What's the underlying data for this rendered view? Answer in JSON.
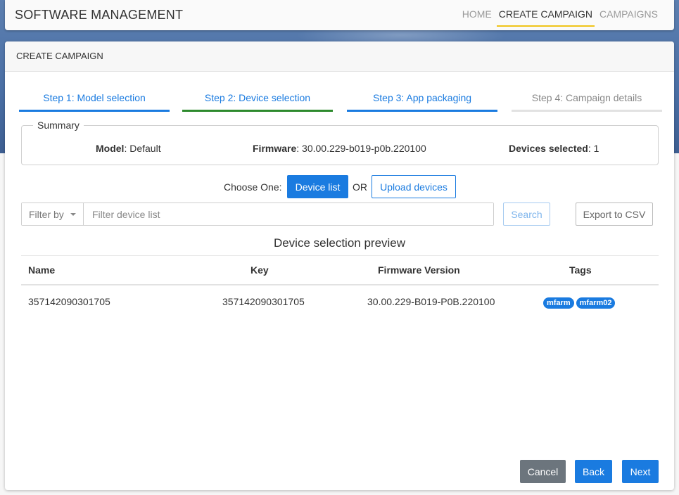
{
  "app": {
    "title": "SOFTWARE MANAGEMENT"
  },
  "nav": {
    "items": [
      {
        "label": "HOME",
        "active": false
      },
      {
        "label": "CREATE CAMPAIGN",
        "active": true
      },
      {
        "label": "CAMPAIGNS",
        "active": false
      }
    ]
  },
  "card": {
    "title": "CREATE CAMPAIGN"
  },
  "steps": [
    {
      "label": "Step 1: Model selection",
      "state": "complete"
    },
    {
      "label": "Step 2: Device selection",
      "state": "current"
    },
    {
      "label": "Step 3: App packaging",
      "state": "complete"
    },
    {
      "label": "Step 4: Campaign details",
      "state": "pending"
    }
  ],
  "summary": {
    "legend": "Summary",
    "model_key": "Model",
    "model_value": ": Default",
    "firmware_key": "Firmware",
    "firmware_value": ": 30.00.229-b019-p0b.220100",
    "devices_key": "Devices selected",
    "devices_value": ": 1"
  },
  "choose": {
    "label": "Choose One:",
    "device_list": "Device list",
    "or": "OR",
    "upload": "Upload devices"
  },
  "filter": {
    "filter_by": "Filter by",
    "placeholder": "Filter device list",
    "value": "",
    "search": "Search",
    "export": "Export to CSV"
  },
  "preview": {
    "title": "Device selection preview",
    "columns": [
      "Name",
      "Key",
      "Firmware Version",
      "Tags"
    ],
    "rows": [
      {
        "name": "357142090301705",
        "key": "357142090301705",
        "firmware": "30.00.229-B019-P0B.220100",
        "tags": [
          "mfarm",
          "mfarm02"
        ]
      }
    ]
  },
  "footer": {
    "cancel": "Cancel",
    "back": "Back",
    "next": "Next"
  },
  "colors": {
    "primary": "#1a7be0",
    "step_current": "#2d8a2d",
    "nav_active_underline": "#f0c419",
    "cancel": "#6c757d"
  }
}
